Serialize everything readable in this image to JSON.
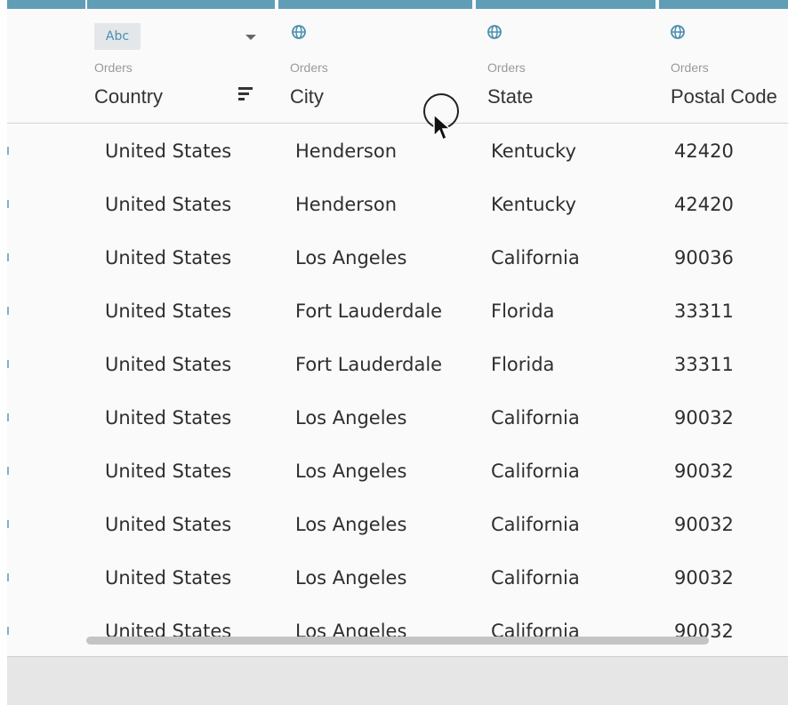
{
  "columns": [
    {
      "source": "Orders",
      "field": "Country",
      "type_badge": "Abc",
      "type": "string",
      "sorted": true
    },
    {
      "source": "Orders",
      "field": "City",
      "type_icon": "globe-icon",
      "type": "geographic"
    },
    {
      "source": "Orders",
      "field": "State",
      "type_icon": "globe-icon",
      "type": "geographic"
    },
    {
      "source": "Orders",
      "field": "Postal Code",
      "type_icon": "globe-icon",
      "type": "geographic"
    }
  ],
  "rows": [
    [
      "United States",
      "Henderson",
      "Kentucky",
      "42420"
    ],
    [
      "United States",
      "Henderson",
      "Kentucky",
      "42420"
    ],
    [
      "United States",
      "Los Angeles",
      "California",
      "90036"
    ],
    [
      "United States",
      "Fort Lauderdale",
      "Florida",
      "33311"
    ],
    [
      "United States",
      "Fort Lauderdale",
      "Florida",
      "33311"
    ],
    [
      "United States",
      "Los Angeles",
      "California",
      "90032"
    ],
    [
      "United States",
      "Los Angeles",
      "California",
      "90032"
    ],
    [
      "United States",
      "Los Angeles",
      "California",
      "90032"
    ],
    [
      "United States",
      "Los Angeles",
      "California",
      "90032"
    ],
    [
      "United States",
      "Los Angeles",
      "California",
      "90032"
    ]
  ],
  "colors": {
    "accent": "#5f9eb5",
    "icon": "#4a8fb0",
    "text": "#2e2e2e",
    "muted": "#9a9a9a"
  }
}
